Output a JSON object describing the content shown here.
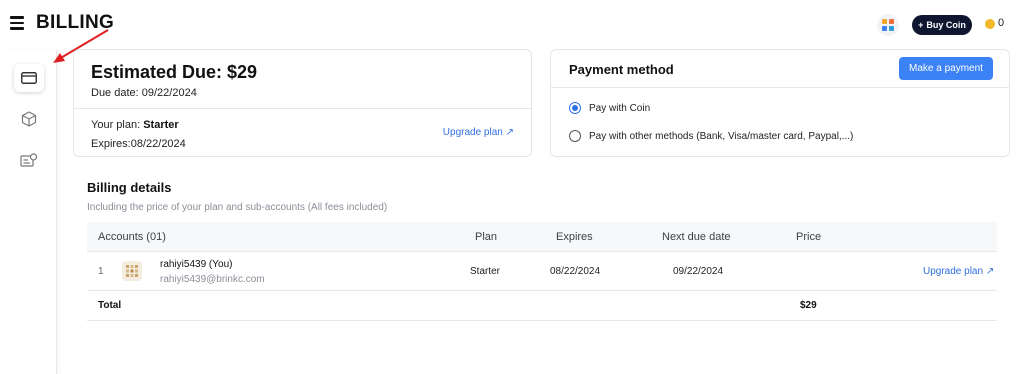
{
  "header": {
    "title": "BILLING",
    "buy_coin_label": "Buy Coin",
    "coin_count": "0"
  },
  "sidebar": {
    "items": [
      {
        "name": "billing",
        "icon": "credit-card-icon",
        "active": true
      },
      {
        "name": "packages",
        "icon": "box-icon",
        "active": false
      },
      {
        "name": "sub-accounts",
        "icon": "id-card-icon",
        "active": false
      }
    ]
  },
  "due_card": {
    "title": "Estimated Due: $29",
    "due_date": "Due date: 09/22/2024",
    "plan_label": "Your plan: ",
    "plan_value": "Starter",
    "expires": "Expires:08/22/2024",
    "upgrade_label": "Upgrade plan ↗"
  },
  "payment": {
    "title": "Payment method",
    "make_payment_label": "Make a payment",
    "options": [
      {
        "label": "Pay with Coin",
        "selected": true
      },
      {
        "label": "Pay with other methods (Bank, Visa/master card, Paypal,...)",
        "selected": false
      }
    ]
  },
  "billing_details": {
    "title": "Billing details",
    "subtitle": "Including the price of your plan and sub-accounts (All fees included)",
    "columns": [
      "Accounts (01)",
      "Plan",
      "Expires",
      "Next due date",
      "Price"
    ],
    "rows": [
      {
        "index": "1",
        "name": "rahiyi5439 (You)",
        "email": "rahiyi5439@brinkc.com",
        "plan": "Starter",
        "expires": "08/22/2024",
        "next_due": "09/22/2024",
        "price": "",
        "action": "Upgrade plan ↗"
      }
    ],
    "total_label": "Total",
    "total_value": "$29"
  },
  "colors": {
    "accent": "#3b82f6",
    "link": "#2f6fe0",
    "dark": "#0e1630",
    "coin": "#f3b82a",
    "annotation_arrow": "#e02020"
  }
}
